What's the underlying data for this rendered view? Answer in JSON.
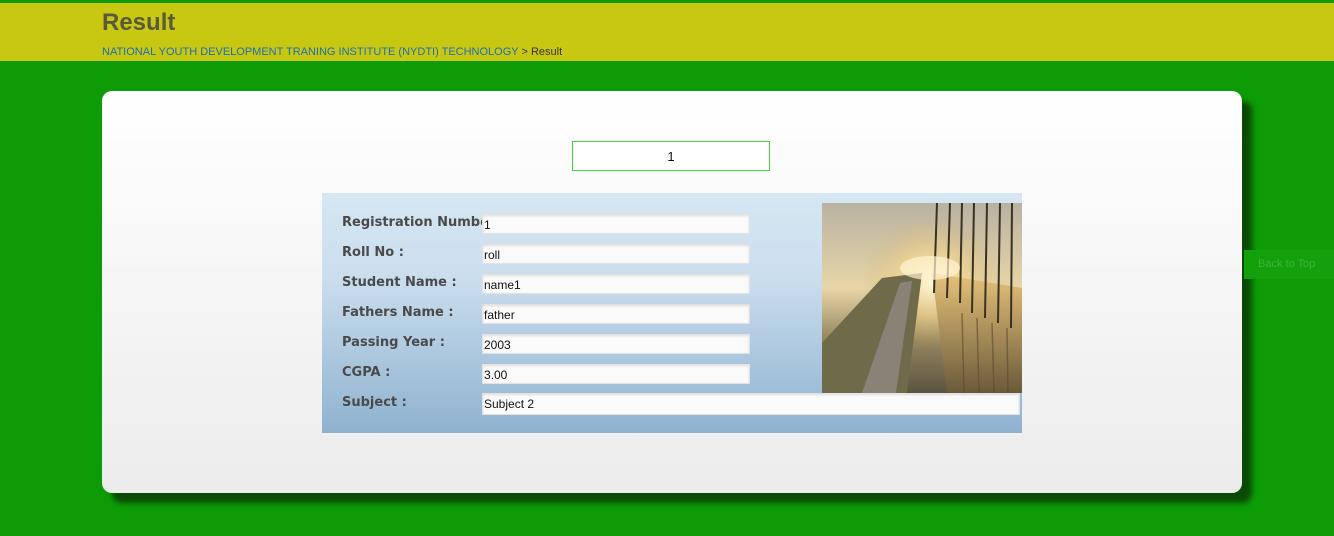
{
  "header": {
    "title": "Result",
    "breadcrumb": {
      "link": "NATIONAL YOUTH DEVELOPMENT TRANING INSTITUTE (NYDTI) TECHNOLOGY",
      "separator": " > ",
      "current": "Result"
    }
  },
  "search": {
    "value": "1"
  },
  "result": {
    "rows": [
      {
        "label": "Registration Number :",
        "value": "1"
      },
      {
        "label": "Roll No :",
        "value": "roll"
      },
      {
        "label": "Student Name :",
        "value": "name1"
      },
      {
        "label": "Fathers Name :",
        "value": "father"
      },
      {
        "label": "Passing Year :",
        "value": "2003"
      },
      {
        "label": "CGPA :",
        "value": "3.00"
      },
      {
        "label": "Subject :",
        "value": "Subject 2"
      }
    ]
  },
  "back_to_top": "Back to Top",
  "colors": {
    "background": "#0d9c06",
    "header": "#c8c812",
    "link": "#1a6fb5",
    "input_border": "#44d33c"
  }
}
